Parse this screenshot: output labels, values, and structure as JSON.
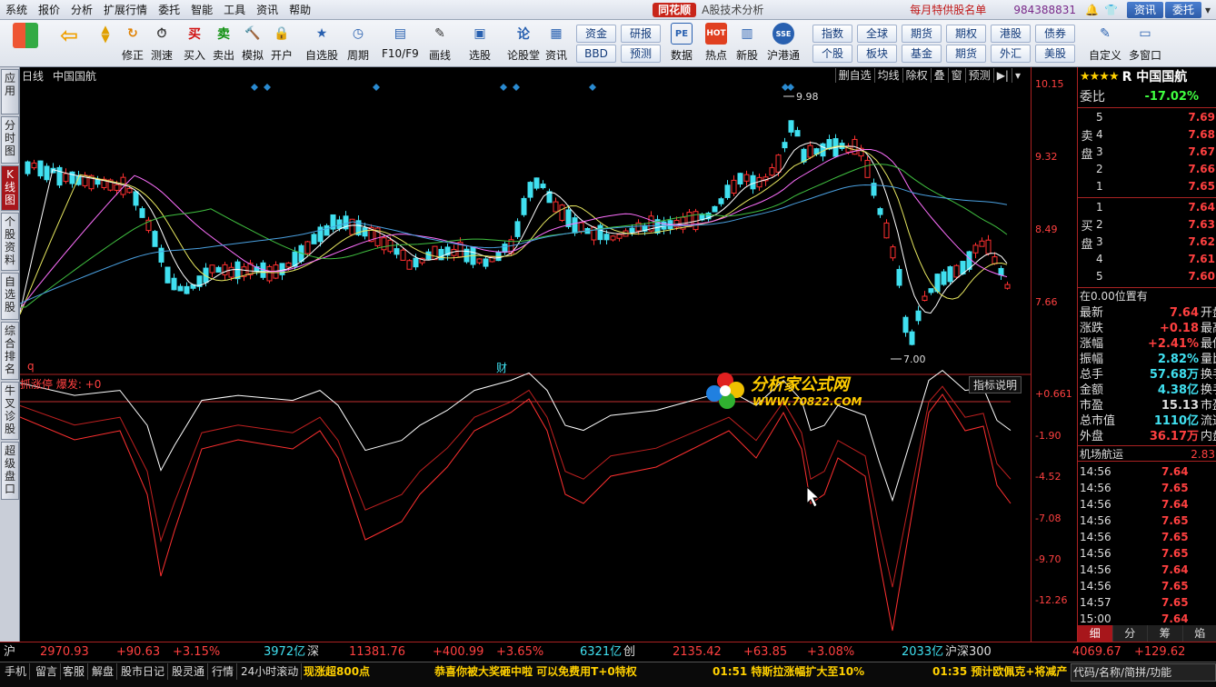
{
  "menu": {
    "items": [
      "系统",
      "报价",
      "分析",
      "扩展行情",
      "委托",
      "智能",
      "工具",
      "资讯",
      "帮助"
    ],
    "logo": "同花顺",
    "subtitle": "A股技术分析",
    "promo": "每月特供股名单",
    "phone": "984388831",
    "buttons": [
      "资讯",
      "委托"
    ]
  },
  "toolbar": {
    "main": [
      "修正",
      "测速",
      "买入",
      "卖出",
      "模拟",
      "开户",
      "自选股",
      "周期",
      "F10/F9",
      "画线",
      "选股",
      "论股堂",
      "资讯",
      "数据",
      "热点",
      "新股",
      "沪港通",
      "自定义",
      "多窗口"
    ],
    "small": [
      "资金",
      "BBD",
      "研报",
      "预测",
      "指数",
      "个股",
      "全球",
      "板块",
      "期货",
      "基金",
      "期权",
      "期货",
      "港股",
      "外汇",
      "债券",
      "美股"
    ]
  },
  "left_tabs": [
    "应用",
    "分时图",
    "K线图",
    "个股资料",
    "自选股",
    "综合排名",
    "牛叉诊股",
    "超级盘口"
  ],
  "chart": {
    "period": "日线",
    "stock_name": "中国国航",
    "tools": [
      "删自选",
      "均线",
      "除权",
      "叠",
      "窗",
      "预测"
    ],
    "high_label": "9.98",
    "low_label": "7.00",
    "marker_q": "q",
    "marker_cai": "财",
    "indicator": {
      "name": "抓涨停 爆发: +0",
      "help": "指标说明"
    }
  },
  "watermark": {
    "title": "分析家公式网",
    "url": "WWW.70822.COM"
  },
  "axis": {
    "price_ticks": [
      "10.15",
      "9.32",
      "8.49",
      "7.66"
    ],
    "ind_ticks": [
      "+0.661",
      "-1.90",
      "-4.52",
      "-7.08",
      "-9.70",
      "-12.26"
    ]
  },
  "colors": {
    "up": "#ff3030",
    "down": "#40e0f0",
    "ma5": "#ffffff",
    "ma10": "#e8e860",
    "ma20": "#ff70ff",
    "ma30": "#40c040",
    "ma60": "#4aa0e0"
  },
  "quote": {
    "title": "R 中国国航",
    "weibi_label": "委比",
    "weibi": "-17.02%",
    "sell_label": "卖盘",
    "buy_label": "买盘",
    "sell": [
      {
        "n": "5",
        "p": "7.69"
      },
      {
        "n": "4",
        "p": "7.68"
      },
      {
        "n": "3",
        "p": "7.67"
      },
      {
        "n": "2",
        "p": "7.66"
      },
      {
        "n": "1",
        "p": "7.65"
      }
    ],
    "buy": [
      {
        "n": "1",
        "p": "7.64"
      },
      {
        "n": "2",
        "p": "7.63"
      },
      {
        "n": "3",
        "p": "7.62"
      },
      {
        "n": "4",
        "p": "7.61"
      },
      {
        "n": "5",
        "p": "7.60"
      }
    ],
    "position": "在0.00位置有",
    "stats": [
      {
        "k": "最新",
        "v": "7.64",
        "x": "开盘",
        "c": "#ff4040"
      },
      {
        "k": "涨跌",
        "v": "+0.18",
        "x": "最高",
        "c": "#ff4040"
      },
      {
        "k": "涨幅",
        "v": "+2.41%",
        "x": "最低",
        "c": "#ff4040"
      },
      {
        "k": "振幅",
        "v": "2.82%",
        "x": "量比",
        "c": "#40e0f0"
      },
      {
        "k": "总手",
        "v": "57.68万",
        "x": "换手",
        "c": "#40e0f0"
      },
      {
        "k": "金额",
        "v": "4.38亿",
        "x": "换手",
        "c": "#40e0f0"
      },
      {
        "k": "市盈",
        "v": "15.13",
        "x": "市盈",
        "c": "#dddddd"
      },
      {
        "k": "总市值",
        "v": "1110亿",
        "x": "流通",
        "c": "#40e0f0"
      },
      {
        "k": "外盘",
        "v": "36.17万",
        "x": "内盘",
        "c": "#ff4040"
      }
    ],
    "sector": "机场航运",
    "sector_value": "2.83",
    "ticks": [
      {
        "t": "14:56",
        "p": "7.64",
        "q": ""
      },
      {
        "t": "14:56",
        "p": "7.65",
        "q": ""
      },
      {
        "t": "14:56",
        "p": "7.64",
        "q": ""
      },
      {
        "t": "14:56",
        "p": "7.65",
        "q": ""
      },
      {
        "t": "14:56",
        "p": "7.65",
        "q": ""
      },
      {
        "t": "14:56",
        "p": "7.65",
        "q": ""
      },
      {
        "t": "14:56",
        "p": "7.64",
        "q": ""
      },
      {
        "t": "14:56",
        "p": "7.65",
        "q": ""
      },
      {
        "t": "14:57",
        "p": "7.65",
        "q": ""
      },
      {
        "t": "15:00",
        "p": "7.64",
        "q": ""
      }
    ],
    "tabs": [
      "细",
      "分",
      "筹",
      "焰"
    ]
  },
  "indices": {
    "sh_label": "沪",
    "sh": "2970.93",
    "sh_chg": "+90.63",
    "sh_pct": "+3.15%",
    "sh_amt": "3972亿",
    "sz_label": "深",
    "sz": "11381.76",
    "sz_chg": "+400.99",
    "sz_pct": "+3.65%",
    "sz_amt": "6321亿",
    "cy_label": "创",
    "cy": "2135.42",
    "cy_chg": "+63.85",
    "cy_pct": "+3.08%",
    "cy_amt": "2033亿",
    "hs300_label": "沪深300",
    "hs300": "4069.67",
    "hs300_chg": "+129.62"
  },
  "bottom": {
    "buttons": [
      "手机",
      "留言",
      "客服",
      "解盘",
      "股市日记",
      "股灵通",
      "行情",
      "24小时滚动"
    ],
    "news": [
      "现涨超800点",
      "恭喜你被大奖砸中啦 可以免费用T+0特权",
      "01:51 特斯拉涨幅扩大至10%",
      "01:35 预计欧佩克+将减产"
    ],
    "search": "代码/名称/简拼/功能"
  }
}
